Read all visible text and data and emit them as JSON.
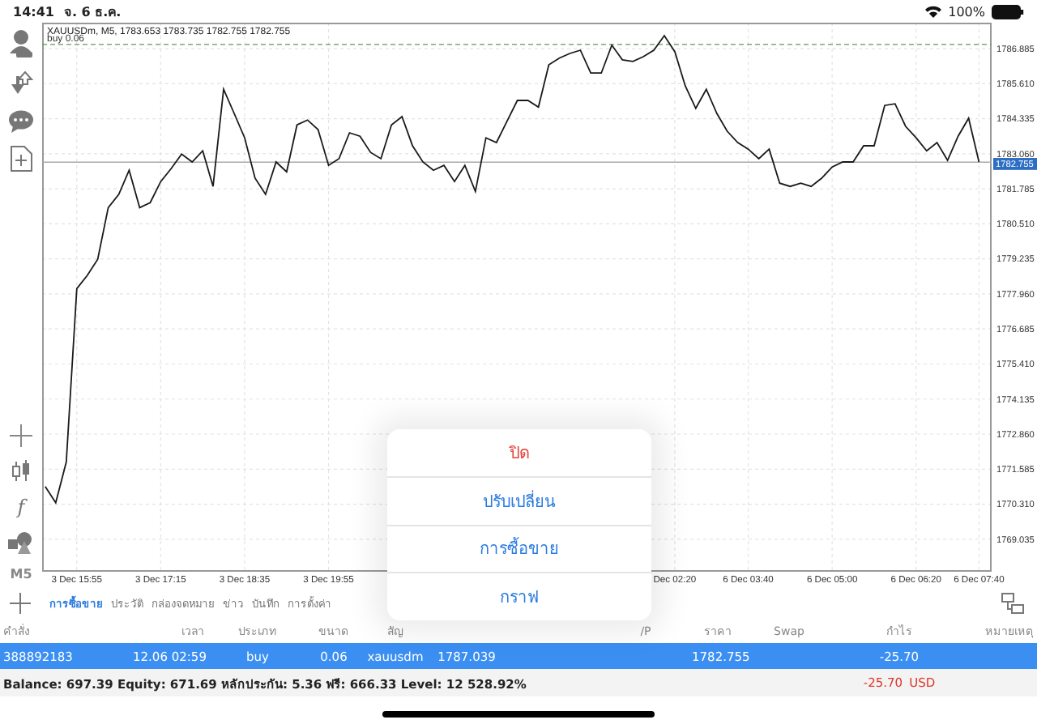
{
  "status_bar": {
    "time": "14:41",
    "date": "จ. 6 ธ.ค.",
    "battery": "100%"
  },
  "toolbar": {
    "indicator_glyph": "f",
    "timeframe": "M5"
  },
  "chart": {
    "chart_data": {
      "type": "line",
      "title": "XAUUSDm, M5, 1783.653 1783.735 1782.755 1782.755",
      "grid": true,
      "ylim": [
        1767.91,
        1787.83
      ],
      "categories": [
        null,
        null,
        null,
        "3 Dec 15:55",
        null,
        null,
        null,
        null,
        null,
        null,
        null,
        "3 Dec 17:15",
        null,
        null,
        null,
        null,
        null,
        null,
        null,
        "3 Dec 18:35",
        null,
        null,
        null,
        null,
        null,
        null,
        null,
        "3 Dec 19:55",
        null,
        null,
        null,
        null,
        null,
        null,
        null,
        null,
        null,
        null,
        null,
        null,
        null,
        null,
        null,
        null,
        null,
        null,
        null,
        null,
        null,
        null,
        null,
        null,
        null,
        null,
        null,
        null,
        null,
        null,
        null,
        null,
        "Dec 02:20",
        null,
        null,
        null,
        null,
        null,
        null,
        "6 Dec 03:40",
        null,
        null,
        null,
        null,
        null,
        null,
        null,
        "6 Dec 05:00",
        null,
        null,
        null,
        null,
        null,
        null,
        null,
        "6 Dec 06:20",
        null,
        null,
        null,
        null,
        null,
        "6 Dec 07:40"
      ],
      "series": [
        {
          "color": "#1a1a1a",
          "values": [
            1770.95,
            1770.36,
            1771.84,
            1778.15,
            1778.63,
            1779.22,
            1781.1,
            1781.58,
            1782.46,
            1781.1,
            1781.28,
            1782.05,
            1782.52,
            1783.05,
            1782.76,
            1783.17,
            1781.87,
            1785.41,
            1784.53,
            1783.64,
            1782.17,
            1781.58,
            1782.76,
            1782.4,
            1784.11,
            1784.29,
            1783.94,
            1782.64,
            1782.88,
            1783.82,
            1783.7,
            1783.11,
            1782.88,
            1784.11,
            1784.41,
            1783.35,
            1782.76,
            1782.46,
            1782.64,
            1782.05,
            1782.64,
            1781.69,
            1783.64,
            1783.47,
            1784.23,
            1785.0,
            1785.0,
            1784.76,
            1786.3,
            1786.54,
            1786.71,
            1786.83,
            1786.0,
            1786.0,
            1787.01,
            1786.48,
            1786.42,
            1786.59,
            1786.83,
            1787.36,
            1786.77,
            1785.53,
            1784.71,
            1785.41,
            1784.53,
            1783.88,
            1783.47,
            1783.23,
            1782.88,
            1783.23,
            1781.99,
            1781.87,
            1781.99,
            1781.87,
            1782.17,
            1782.58,
            1782.76,
            1782.76,
            1783.35,
            1783.35,
            1784.82,
            1784.88,
            1784.06,
            1783.64,
            1783.17,
            1783.47,
            1782.82,
            1783.7,
            1784.35,
            1782.76
          ]
        }
      ],
      "yticks": [
        {
          "value": 1786.885,
          "label": "1786.885"
        },
        {
          "value": 1785.61,
          "label": "1785.610"
        },
        {
          "value": 1784.335,
          "label": "1784.335"
        },
        {
          "value": 1783.06,
          "label": "1783.060"
        },
        {
          "value": 1781.785,
          "label": "1781.785"
        },
        {
          "value": 1780.51,
          "label": "1780.510"
        },
        {
          "value": 1779.235,
          "label": "1779.235"
        },
        {
          "value": 1777.96,
          "label": "1777.960"
        },
        {
          "value": 1776.685,
          "label": "1776.685"
        },
        {
          "value": 1775.41,
          "label": "1775.410"
        },
        {
          "value": 1774.135,
          "label": "1774.135"
        },
        {
          "value": 1772.86,
          "label": "1772.860"
        },
        {
          "value": 1771.585,
          "label": "1771.585"
        },
        {
          "value": 1770.31,
          "label": "1770.310"
        },
        {
          "value": 1769.035,
          "label": "1769.035"
        }
      ],
      "ref_lines": [
        {
          "axis": "y",
          "value": 1787.039,
          "label": "buy 0.06",
          "color": "#5a9a5a"
        },
        {
          "axis": "y",
          "value": 1782.755,
          "label": "1782.755",
          "color": "#aaaaaa"
        }
      ]
    }
  },
  "tabs": [
    {
      "label": "การซื้อขาย",
      "selected": true
    },
    {
      "label": "ประวัติ",
      "selected": false
    },
    {
      "label": "กล่องจดหมาย",
      "selected": false
    },
    {
      "label": "ข่าว",
      "selected": false
    },
    {
      "label": "บันทึก",
      "selected": false
    },
    {
      "label": "การตั้งค่า",
      "selected": false
    }
  ],
  "table": {
    "columns": {
      "order": "คำสั่ง",
      "time": "เวลา",
      "type": "ประเภท",
      "volume": "ขนาด",
      "symbol": "สัญ",
      "take_profit": "/P",
      "price": "ราคา",
      "swap": "Swap",
      "profit": "กำไร",
      "comment": "หมายเหตุ"
    },
    "rows": [
      {
        "selected": true,
        "order": "388892183",
        "time": "12.06 02:59",
        "type": "buy",
        "volume": "0.06",
        "symbol": "xauusdm",
        "open_price": "1787.039",
        "price": "1782.755",
        "profit": "-25.70"
      }
    ]
  },
  "summary": {
    "text": "Balance: 697.39 Equity: 671.69 หลักประกัน: 5.36 ฟรี: 666.33 Level: 12 528.92%",
    "profit": "-25.70",
    "currency": "USD"
  },
  "popup_menu": {
    "items": [
      {
        "label": "ปิด",
        "kind": "destructive"
      },
      {
        "label": "ปรับเปลี่ยน",
        "kind": "action"
      },
      {
        "label": "การซื้อขาย",
        "kind": "action"
      },
      {
        "label": "กราฟ",
        "kind": "action"
      }
    ]
  }
}
